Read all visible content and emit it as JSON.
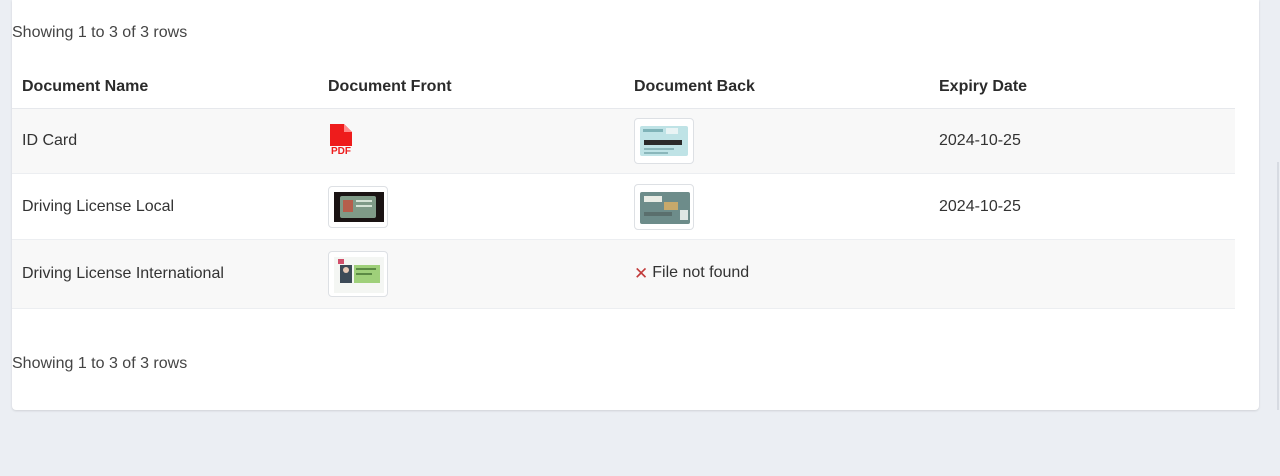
{
  "pagination": {
    "summary_top": "Showing 1 to 3 of 3 rows",
    "summary_bottom": "Showing 1 to 3 of 3 rows"
  },
  "table": {
    "columns": [
      "Document Name",
      "Document Front",
      "Document Back",
      "Expiry Date"
    ],
    "rows": [
      {
        "name": "ID Card",
        "front": {
          "type": "pdf",
          "icon": "pdf-file-icon",
          "label": "PDF"
        },
        "back": {
          "type": "image",
          "icon": "id-card-back-thumbnail"
        },
        "expiry": "2024-10-25"
      },
      {
        "name": "Driving License Local",
        "front": {
          "type": "image",
          "icon": "license-front-thumbnail"
        },
        "back": {
          "type": "image",
          "icon": "license-back-thumbnail"
        },
        "expiry": "2024-10-25"
      },
      {
        "name": "Driving License International",
        "front": {
          "type": "image",
          "icon": "intl-license-thumbnail"
        },
        "back": {
          "type": "missing",
          "icon": "close-icon",
          "text": "File not found"
        },
        "expiry": ""
      }
    ]
  },
  "colors": {
    "page_background": "#ebeef3",
    "card_background": "#ffffff",
    "striped_row": "#f8f8f8",
    "pdf_red": "#ee1c1c",
    "error_red": "#c23b3b"
  }
}
